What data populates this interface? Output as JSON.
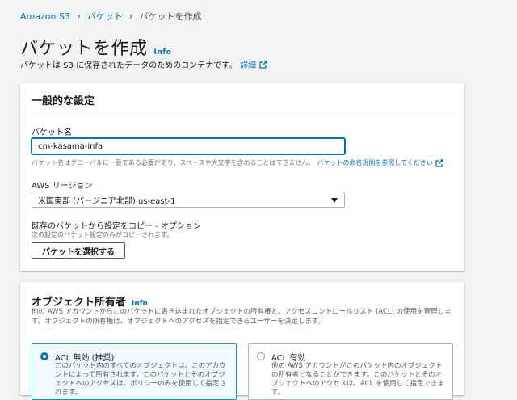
{
  "breadcrumb": {
    "items": [
      "Amazon S3",
      "バケット",
      "バケットを作成"
    ]
  },
  "page": {
    "title": "バケットを作成",
    "info": "Info",
    "description": "バケットは S3 に保存されたデータのためのコンテナです。",
    "details_link": "詳細"
  },
  "general": {
    "header": "一般的な設定",
    "bucket_name_label": "バケット名",
    "bucket_name_value": "cm-kasama-infa",
    "bucket_name_hint": "バケット名はグローバルに一意である必要があり、スペースや大文字を含めることはできません。",
    "bucket_name_rules_link": "バケットの命名規則を参照してください",
    "region_label": "AWS リージョン",
    "region_value": "米国東部 (バージニア北部) us-east-1",
    "copy_label": "既存のバケットから設定をコピー - オプション",
    "copy_hint": "次の設定のバケット設定のみがコピーされます。",
    "choose_bucket_button": "バケットを選択する"
  },
  "ownership": {
    "title": "オブジェクト所有者",
    "info": "Info",
    "description": "他の AWS アカウントからこのバケットに書き込まれたオブジェクトの所有権と、アクセスコントロールリスト (ACL) の使用を管理します。オブジェクトの所有権は、オブジェクトへのアクセスを指定できるユーザーを決定します。",
    "options": [
      {
        "title": "ACL 無効 (推奨)",
        "description": "このバケット内のすべてのオブジェクトは、このアカウントによって所有されます。このバケットとそのオブジェクトへのアクセスは、ポリシーのみを使用して指定されます。",
        "selected": true
      },
      {
        "title": "ACL 有効",
        "description": "他の AWS アカウントがこのバケット内のオブジェクトの所有者となることができます。このバケットとそのオブジェクトへのアクセスは、ACL を使用して指定できます。",
        "selected": false
      }
    ]
  },
  "colors": {
    "link": "#0073bb",
    "background": "#f2f3f3",
    "selected_tile_border": "#00a1c9"
  }
}
